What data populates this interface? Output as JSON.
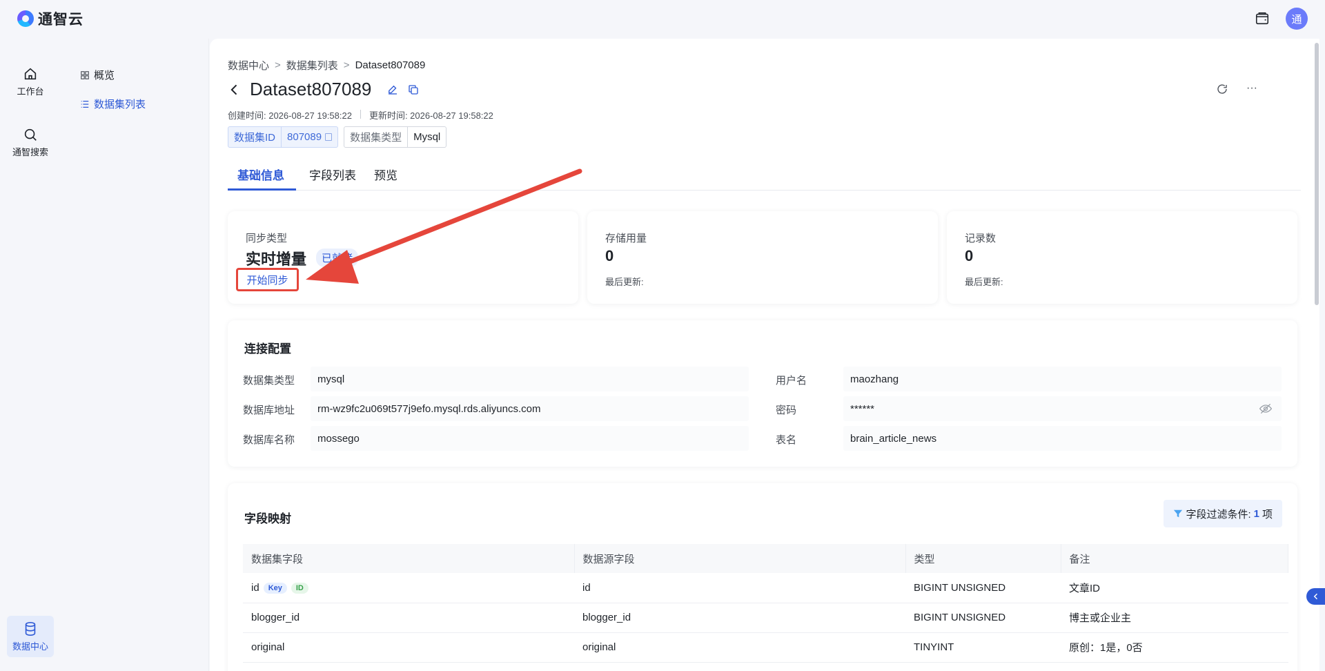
{
  "app": {
    "name": "通智云",
    "avatar_letter": "通"
  },
  "rail": {
    "workbench": "工作台",
    "search": "通智搜索",
    "data_center": "数据中心"
  },
  "subnav": {
    "overview": "概览",
    "dataset_list": "数据集列表"
  },
  "breadcrumb": {
    "root": "数据中心",
    "parent": "数据集列表",
    "current": "Dataset807089",
    "sep": ">"
  },
  "header": {
    "title": "Dataset807089",
    "created": "创建时间: 2026-08-27 19:58:22",
    "updated": "更新时间: 2026-08-27 19:58:22",
    "more": "···"
  },
  "tags": {
    "id_key": "数据集ID",
    "id_value": "807089",
    "type_key": "数据集类型",
    "type_value": "Mysql"
  },
  "tabs": [
    "基础信息",
    "字段列表",
    "预览"
  ],
  "stats": {
    "sync": {
      "label": "同步类型",
      "value": "实时增量",
      "status": "已就绪",
      "button": "开始同步"
    },
    "storage": {
      "label": "存储用量",
      "value": "0",
      "sub": "最后更新:"
    },
    "records": {
      "label": "记录数",
      "value": "0",
      "sub": "最后更新:"
    }
  },
  "connection": {
    "title": "连接配置",
    "dataset_type_label": "数据集类型",
    "dataset_type": "mysql",
    "username_label": "用户名",
    "username": "maozhang",
    "host_label": "数据库地址",
    "host": "rm-wz9fc2u069t577j9efo.mysql.rds.aliyuncs.com",
    "password_label": "密码",
    "password": "******",
    "dbname_label": "数据库名称",
    "dbname": "mossego",
    "table_label": "表名",
    "table": "brain_article_news"
  },
  "mapping": {
    "title": "字段映射",
    "filter_label": "字段过滤条件:",
    "filter_count": "1",
    "filter_unit": "项",
    "columns": [
      "数据集字段",
      "数据源字段",
      "类型",
      "备注"
    ],
    "key_badge": "Key",
    "id_badge": "ID",
    "rows": [
      {
        "dataset_field": "id",
        "source_field": "id",
        "type": "BIGINT UNSIGNED",
        "note": "文章ID"
      },
      {
        "dataset_field": "blogger_id",
        "source_field": "blogger_id",
        "type": "BIGINT UNSIGNED",
        "note": "博主或企业主"
      },
      {
        "dataset_field": "original",
        "source_field": "original",
        "type": "TINYINT",
        "note": "原创：1是，0否"
      }
    ]
  },
  "colors": {
    "accent": "#2f5ad6",
    "annotation": "#e5463b"
  }
}
